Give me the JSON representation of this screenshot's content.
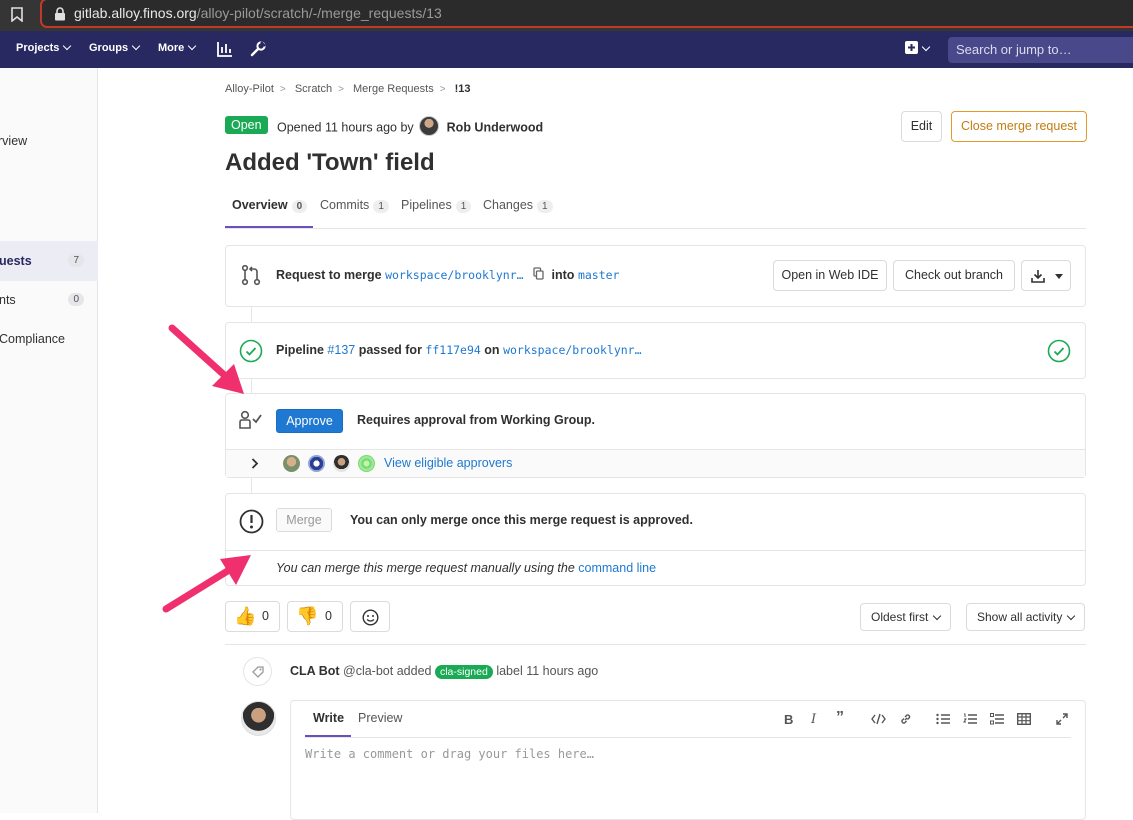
{
  "browser": {
    "url_host": "gitlab.alloy.finos.org",
    "url_path": "/alloy-pilot/scratch/-/merge_requests/13"
  },
  "nav": {
    "projects": "Projects",
    "groups": "Groups",
    "more": "More",
    "search_placeholder": "Search or jump to…"
  },
  "sidebar": {
    "items": [
      {
        "label": "rview"
      },
      {
        "label": "uests",
        "count": "7"
      },
      {
        "label": "nts",
        "count": "0"
      },
      {
        "label": "Compliance"
      }
    ]
  },
  "breadcrumb": [
    "Alloy-Pilot",
    "Scratch",
    "Merge Requests",
    "!13"
  ],
  "mr": {
    "status": "Open",
    "opened_text": "Opened 11 hours ago by",
    "author": "Rob Underwood",
    "title": "Added 'Town' field",
    "edit_label": "Edit",
    "close_label": "Close merge request"
  },
  "tabs": [
    {
      "label": "Overview",
      "count": "0"
    },
    {
      "label": "Commits",
      "count": "1"
    },
    {
      "label": "Pipelines",
      "count": "1"
    },
    {
      "label": "Changes",
      "count": "1"
    }
  ],
  "merge_request_widget": {
    "request_to_merge": "Request to merge",
    "source_branch": "workspace/brooklynr…",
    "into": "into",
    "target_branch": "master",
    "open_web_ide": "Open in Web IDE",
    "check_out_branch": "Check out branch"
  },
  "pipeline": {
    "label": "Pipeline",
    "number": "#137",
    "passed_for": "passed for",
    "commit": "ff117e94",
    "on": "on",
    "branch": "workspace/brooklynr…"
  },
  "approval": {
    "approve_label": "Approve",
    "requirement": "Requires approval from Working Group.",
    "view_approvers": "View eligible approvers"
  },
  "merge": {
    "merge_label": "Merge",
    "message": "You can only merge once this merge request is approved.",
    "manual_text": "You can merge this merge request manually using the",
    "command_line": "command line"
  },
  "awards": {
    "thumbs_up_count": "0",
    "thumbs_down_count": "0"
  },
  "activity": {
    "sort": "Oldest first",
    "filter": "Show all activity"
  },
  "system_note": {
    "author": "CLA Bot",
    "handle": "@cla-bot",
    "added": "added",
    "label": "cla-signed",
    "suffix": "label 11 hours ago"
  },
  "editor": {
    "write": "Write",
    "preview": "Preview",
    "placeholder": "Write a comment or drag your files here…"
  },
  "colors": {
    "nav_bg": "#292961",
    "open_green": "#1aaa55",
    "link_blue": "#1f78d1",
    "close_orange": "#e29a2b",
    "arrow_pink": "#f0306e"
  }
}
